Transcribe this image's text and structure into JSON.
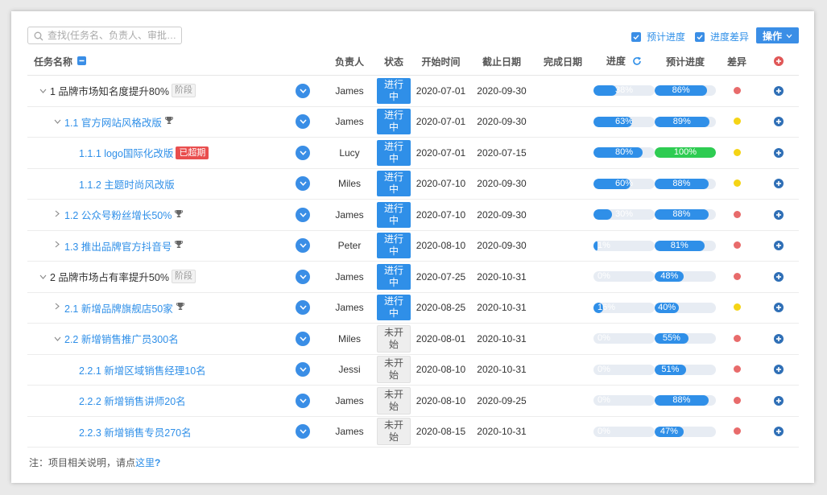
{
  "toolbar": {
    "search_placeholder": "查找(任务名、负责人、审批…",
    "chk_plan": "预计进度",
    "chk_diff": "进度差异",
    "operate": "操作"
  },
  "headers": {
    "name": "任务名称",
    "owner": "负责人",
    "status": "状态",
    "start": "开始时间",
    "deadline": "截止日期",
    "finish": "完成日期",
    "progress": "进度",
    "plan": "预计进度",
    "diff": "差异"
  },
  "rows": [
    {
      "name": "1 品牌市场知名度提升80%",
      "owner": "James",
      "status": "进行中",
      "start": "2020-07-01",
      "deadline": "2020-09-30",
      "finish": "",
      "progress": "38%",
      "plan": "86%"
    },
    {
      "name": "1.1 官方网站风格改版",
      "owner": "James",
      "status": "进行中",
      "start": "2020-07-01",
      "deadline": "2020-09-30",
      "finish": "",
      "progress": "63%",
      "plan": "89%"
    },
    {
      "name": "1.1.1 logo国际化改版",
      "owner": "Lucy",
      "status": "进行中",
      "start": "2020-07-01",
      "deadline": "2020-07-15",
      "finish": "",
      "progress": "80%",
      "plan": "100%"
    },
    {
      "name": "1.1.2 主题时尚风改版",
      "owner": "Miles",
      "status": "进行中",
      "start": "2020-07-10",
      "deadline": "2020-09-30",
      "finish": "",
      "progress": "60%",
      "plan": "88%"
    },
    {
      "name": "1.2 公众号粉丝增长50%",
      "owner": "James",
      "status": "进行中",
      "start": "2020-07-10",
      "deadline": "2020-09-30",
      "finish": "",
      "progress": "30%",
      "plan": "88%"
    },
    {
      "name": "1.3 推出品牌官方抖音号",
      "owner": "Peter",
      "status": "进行中",
      "start": "2020-08-10",
      "deadline": "2020-09-30",
      "finish": "",
      "progress": "1%",
      "plan": "81%"
    },
    {
      "name": "2 品牌市场占有率提升50%",
      "owner": "James",
      "status": "进行中",
      "start": "2020-07-25",
      "deadline": "2020-10-31",
      "finish": "",
      "progress": "0%",
      "plan": "48%"
    },
    {
      "name": "2.1 新增品牌旗舰店50家",
      "owner": "James",
      "status": "进行中",
      "start": "2020-08-25",
      "deadline": "2020-10-31",
      "finish": "",
      "progress": "16%",
      "plan": "40%"
    },
    {
      "name": "2.2 新增销售推广员300名",
      "owner": "Miles",
      "status": "未开始",
      "start": "2020-08-01",
      "deadline": "2020-10-31",
      "finish": "",
      "progress": "0%",
      "plan": "55%"
    },
    {
      "name": "2.2.1 新增区域销售经理10名",
      "owner": "Jessi",
      "status": "未开始",
      "start": "2020-08-10",
      "deadline": "2020-10-31",
      "finish": "",
      "progress": "0%",
      "plan": "51%"
    },
    {
      "name": "2.2.2 新增销售讲师20名",
      "owner": "James",
      "status": "未开始",
      "start": "2020-08-10",
      "deadline": "2020-09-25",
      "finish": "",
      "progress": "0%",
      "plan": "88%"
    },
    {
      "name": "2.2.3 新增销售专员270名",
      "owner": "James",
      "status": "未开始",
      "start": "2020-08-15",
      "deadline": "2020-10-31",
      "finish": "",
      "progress": "0%",
      "plan": "47%"
    }
  ],
  "row_meta": [
    {
      "indent": 0,
      "toggle": "expanded",
      "tag": "阶段",
      "trophy": false,
      "over": "",
      "diff_color": "#e86b6b",
      "progress_value": 0.38,
      "plan_value": 0.86,
      "plan_color": "#2f8fe8"
    },
    {
      "indent": 1,
      "toggle": "expanded",
      "tag": "",
      "trophy": true,
      "over": "",
      "diff_color": "#f5d415",
      "progress_value": 0.63,
      "plan_value": 0.89,
      "plan_color": "#2f8fe8"
    },
    {
      "indent": 2,
      "toggle": "none",
      "tag": "",
      "trophy": false,
      "over": "已超期",
      "diff_color": "#f5d415",
      "progress_value": 0.8,
      "plan_value": 1.0,
      "plan_color": "#2ecc52"
    },
    {
      "indent": 2,
      "toggle": "none",
      "tag": "",
      "trophy": false,
      "over": "",
      "diff_color": "#f5d415",
      "progress_value": 0.6,
      "plan_value": 0.88,
      "plan_color": "#2f8fe8"
    },
    {
      "indent": 1,
      "toggle": "collapsed",
      "tag": "",
      "trophy": true,
      "over": "",
      "diff_color": "#e86b6b",
      "progress_value": 0.3,
      "plan_value": 0.88,
      "plan_color": "#2f8fe8"
    },
    {
      "indent": 1,
      "toggle": "collapsed",
      "tag": "",
      "trophy": true,
      "over": "",
      "diff_color": "#e86b6b",
      "progress_value": 0.01,
      "plan_value": 0.81,
      "plan_color": "#2f8fe8"
    },
    {
      "indent": 0,
      "toggle": "expanded",
      "tag": "阶段",
      "trophy": false,
      "over": "",
      "diff_color": "#e86b6b",
      "progress_value": 0.0,
      "plan_value": 0.48,
      "plan_color": "#2f8fe8"
    },
    {
      "indent": 1,
      "toggle": "collapsed",
      "tag": "",
      "trophy": true,
      "over": "",
      "diff_color": "#f5d415",
      "progress_value": 0.16,
      "plan_value": 0.4,
      "plan_color": "#2f8fe8"
    },
    {
      "indent": 1,
      "toggle": "expanded",
      "tag": "",
      "trophy": false,
      "over": "",
      "diff_color": "#e86b6b",
      "progress_value": 0.0,
      "plan_value": 0.55,
      "plan_color": "#2f8fe8"
    },
    {
      "indent": 2,
      "toggle": "none",
      "tag": "",
      "trophy": false,
      "over": "",
      "diff_color": "#e86b6b",
      "progress_value": 0.0,
      "plan_value": 0.51,
      "plan_color": "#2f8fe8"
    },
    {
      "indent": 2,
      "toggle": "none",
      "tag": "",
      "trophy": false,
      "over": "",
      "diff_color": "#e86b6b",
      "progress_value": 0.0,
      "plan_value": 0.88,
      "plan_color": "#2f8fe8"
    },
    {
      "indent": 2,
      "toggle": "none",
      "tag": "",
      "trophy": false,
      "over": "",
      "diff_color": "#e86b6b",
      "progress_value": 0.0,
      "plan_value": 0.47,
      "plan_color": "#2f8fe8"
    }
  ],
  "footer": {
    "prefix": "注：项目相关说明，请点",
    "link": "这里",
    "q": "?"
  },
  "icons": {
    "search": "search-icon",
    "refresh": "refresh-icon",
    "collapse": "minus-square-icon",
    "row_action": "chevron-down-circle-icon",
    "add": "plus-circle-icon",
    "trophy": "trophy-icon"
  }
}
